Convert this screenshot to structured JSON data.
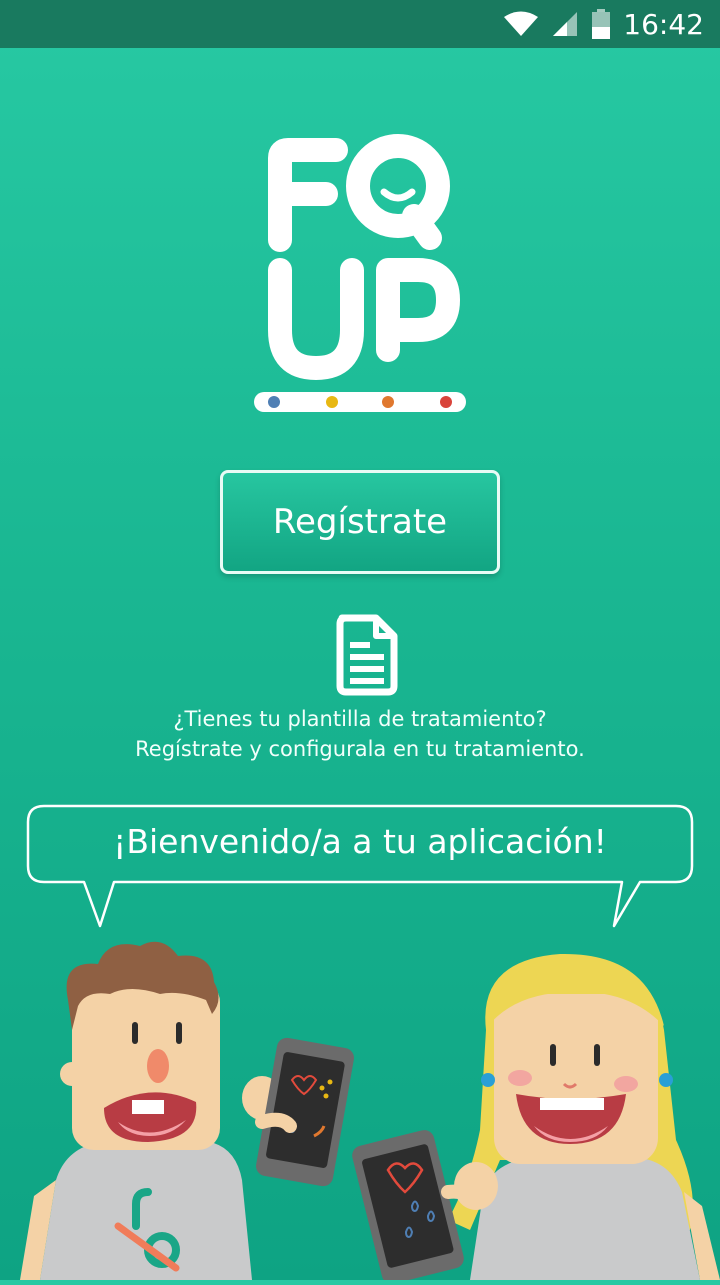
{
  "status_bar": {
    "time": "16:42",
    "icons": [
      "wifi-icon",
      "cell-signal-icon",
      "battery-icon"
    ]
  },
  "logo": {
    "line1": "FQ",
    "line2": "UP",
    "dot_colors": [
      "#4f7fb4",
      "#e8b813",
      "#e0782f",
      "#d9443b"
    ]
  },
  "register_button": {
    "label": "Regístrate"
  },
  "document_icon": "document-icon",
  "info": {
    "line1": "¿Tienes tu plantilla de tratamiento?",
    "line2": "Regístrate y configurala en tu tratamiento."
  },
  "welcome": {
    "text": "¡Bienvenido/a a tu aplicación!"
  },
  "illustration": {
    "shirt_logo": "fo"
  },
  "colors": {
    "background_top": "#27c9a3",
    "background_bottom": "#0ea383",
    "status_bar": "#197a5f"
  }
}
